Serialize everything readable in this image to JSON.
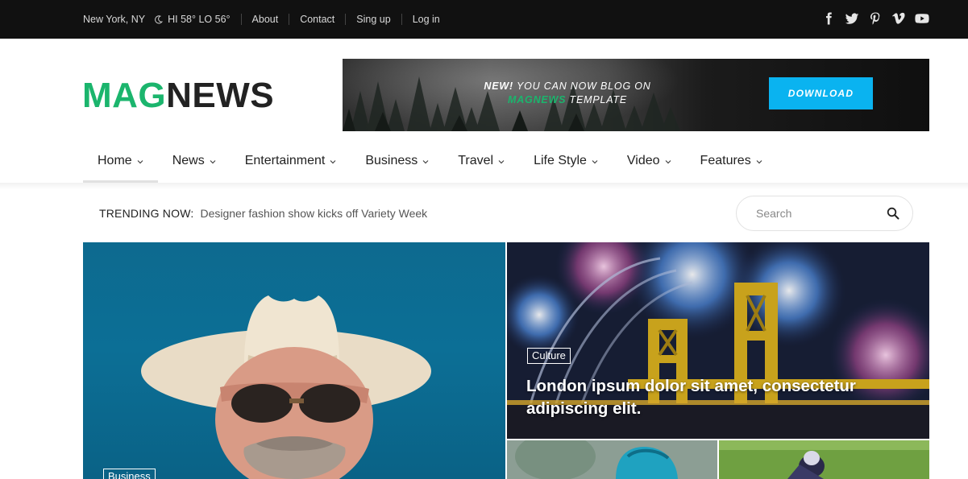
{
  "topbar": {
    "location": "New York, NY",
    "weather": "HI 58° LO 56°",
    "links": [
      "About",
      "Contact",
      "Sing up",
      "Log in"
    ],
    "social_icons": [
      "facebook-icon",
      "twitter-icon",
      "pinterest-icon",
      "vimeo-icon",
      "youtube-icon"
    ]
  },
  "logo": {
    "part1": "MAG",
    "part2": "NEWS"
  },
  "banner": {
    "line1_strong": "NEW!",
    "line1_rest": " YOU CAN NOW BLOG ON",
    "line2_brand": "MAGNEWS",
    "line2_rest": " TEMPLATE",
    "button": "DOWNLOAD"
  },
  "nav": {
    "items": [
      "Home",
      "News",
      "Entertainment",
      "Business",
      "Travel",
      "Life Style",
      "Video",
      "Features"
    ],
    "active": "Home"
  },
  "trending": {
    "label": "TRENDING NOW:",
    "text": "Designer fashion show kicks off Variety Week"
  },
  "search": {
    "placeholder": "Search"
  },
  "hero": {
    "big": {
      "tag": "Business"
    },
    "top_right": {
      "tag": "Culture",
      "title_line1": "London ipsum dolor sit amet, consectetur",
      "title_line2": "adipiscing elit."
    }
  },
  "colors": {
    "brand_green": "#1bb56d",
    "download_blue": "#0ab3f0",
    "topbar_bg": "#111111"
  }
}
